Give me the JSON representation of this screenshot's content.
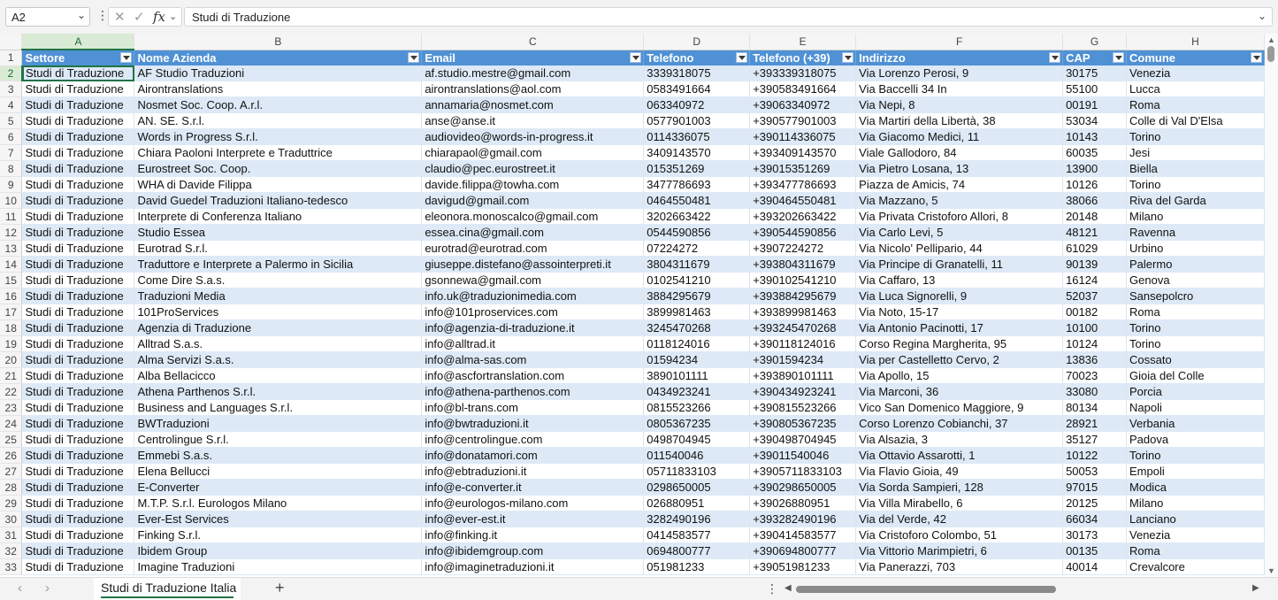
{
  "formula_bar": {
    "name_box": "A2",
    "formula": "Studi di Traduzione"
  },
  "columns": [
    "A",
    "B",
    "C",
    "D",
    "E",
    "F",
    "G",
    "H"
  ],
  "header_row_number": "1",
  "table_headers": [
    "Settore",
    "Nome Azienda",
    "Email",
    "Telefono",
    "Telefono (+39)",
    "Indirizzo",
    "CAP",
    "Comune"
  ],
  "rows": [
    {
      "n": "2",
      "cells": [
        "Studi di Traduzione",
        "AF Studio Traduzioni",
        "af.studio.mestre@gmail.com",
        "3339318075",
        "+393339318075",
        "Via Lorenzo Perosi, 9",
        "30175",
        "Venezia"
      ]
    },
    {
      "n": "3",
      "cells": [
        "Studi di Traduzione",
        "Airontranslations",
        "airontranslations@aol.com",
        "0583491664",
        "+390583491664",
        "Via Baccelli 34 In",
        "55100",
        "Lucca"
      ]
    },
    {
      "n": "4",
      "cells": [
        "Studi di Traduzione",
        "Nosmet Soc. Coop. A.r.l.",
        "annamaria@nosmet.com",
        "063340972",
        "+39063340972",
        "Via Nepi, 8",
        "00191",
        "Roma"
      ]
    },
    {
      "n": "5",
      "cells": [
        "Studi di Traduzione",
        "AN. SE. S.r.l.",
        "anse@anse.it",
        "0577901003",
        "+390577901003",
        "Via Martiri della Libertà, 38",
        "53034",
        "Colle di Val D'Elsa"
      ]
    },
    {
      "n": "6",
      "cells": [
        "Studi di Traduzione",
        "Words in Progress S.r.l.",
        "audiovideo@words-in-progress.it",
        "0114336075",
        "+390114336075",
        "Via Giacomo Medici, 11",
        "10143",
        "Torino"
      ]
    },
    {
      "n": "7",
      "cells": [
        "Studi di Traduzione",
        "Chiara Paoloni Interprete e Traduttrice",
        "chiarapaol@gmail.com",
        "3409143570",
        "+393409143570",
        "Viale Gallodoro, 84",
        "60035",
        "Jesi"
      ]
    },
    {
      "n": "8",
      "cells": [
        "Studi di Traduzione",
        "Eurostreet Soc. Coop.",
        "claudio@pec.eurostreet.it",
        "015351269",
        "+39015351269",
        "Via Pietro Losana, 13",
        "13900",
        "Biella"
      ]
    },
    {
      "n": "9",
      "cells": [
        "Studi di Traduzione",
        "WHA di Davide Filippa",
        "davide.filippa@towha.com",
        "3477786693",
        "+393477786693",
        "Piazza de Amicis, 74",
        "10126",
        "Torino"
      ]
    },
    {
      "n": "10",
      "cells": [
        "Studi di Traduzione",
        "David Guedel Traduzioni Italiano-tedesco",
        "davigud@gmail.com",
        "0464550481",
        "+390464550481",
        "Via Mazzano, 5",
        "38066",
        "Riva del Garda"
      ]
    },
    {
      "n": "11",
      "cells": [
        "Studi di Traduzione",
        "Interprete di Conferenza Italiano",
        "eleonora.monoscalco@gmail.com",
        "3202663422",
        "+393202663422",
        "Via Privata Cristoforo Allori, 8",
        "20148",
        "Milano"
      ]
    },
    {
      "n": "12",
      "cells": [
        "Studi di Traduzione",
        "Studio Essea",
        "essea.cina@gmail.com",
        "0544590856",
        "+390544590856",
        "Via Carlo Levi, 5",
        "48121",
        "Ravenna"
      ]
    },
    {
      "n": "13",
      "cells": [
        "Studi di Traduzione",
        "Eurotrad S.r.l.",
        "eurotrad@eurotrad.com",
        "07224272",
        "+3907224272",
        "Via Nicolo' Pellipario, 44",
        "61029",
        "Urbino"
      ]
    },
    {
      "n": "14",
      "cells": [
        "Studi di Traduzione",
        "Traduttore e Interprete a Palermo in Sicilia",
        "giuseppe.distefano@assointerpreti.it",
        "3804311679",
        "+393804311679",
        "Via Principe di Granatelli, 11",
        "90139",
        "Palermo"
      ]
    },
    {
      "n": "15",
      "cells": [
        "Studi di Traduzione",
        "Come Dire S.a.s.",
        "gsonnewa@gmail.com",
        "0102541210",
        "+390102541210",
        "Via Caffaro, 13",
        "16124",
        "Genova"
      ]
    },
    {
      "n": "16",
      "cells": [
        "Studi di Traduzione",
        "Traduzioni Media",
        "info.uk@traduzionimedia.com",
        "3884295679",
        "+393884295679",
        "Via Luca Signorelli, 9",
        "52037",
        "Sansepolcro"
      ]
    },
    {
      "n": "17",
      "cells": [
        "Studi di Traduzione",
        "101ProServices",
        "info@101proservices.com",
        "3899981463",
        "+393899981463",
        "Via Noto, 15-17",
        "00182",
        "Roma"
      ]
    },
    {
      "n": "18",
      "cells": [
        "Studi di Traduzione",
        "Agenzia di Traduzione",
        "info@agenzia-di-traduzione.it",
        "3245470268",
        "+393245470268",
        "Via Antonio Pacinotti, 17",
        "10100",
        "Torino"
      ]
    },
    {
      "n": "19",
      "cells": [
        "Studi di Traduzione",
        "Alltrad S.a.s.",
        "info@alltrad.it",
        "0118124016",
        "+390118124016",
        "Corso Regina Margherita, 95",
        "10124",
        "Torino"
      ]
    },
    {
      "n": "20",
      "cells": [
        "Studi di Traduzione",
        "Alma Servizi S.a.s.",
        "info@alma-sas.com",
        "01594234",
        "+3901594234",
        "Via per Castelletto Cervo, 2",
        "13836",
        "Cossato"
      ]
    },
    {
      "n": "21",
      "cells": [
        "Studi di Traduzione",
        "Alba Bellacicco",
        "info@ascfortranslation.com",
        "3890101111",
        "+393890101111",
        "Via Apollo, 15",
        "70023",
        "Gioia del Colle"
      ]
    },
    {
      "n": "22",
      "cells": [
        "Studi di Traduzione",
        "Athena Parthenos S.r.l.",
        "info@athena-parthenos.com",
        "0434923241",
        "+390434923241",
        "Via Marconi, 36",
        "33080",
        "Porcia"
      ]
    },
    {
      "n": "23",
      "cells": [
        "Studi di Traduzione",
        "Business and Languages S.r.l.",
        "info@bl-trans.com",
        "0815523266",
        "+390815523266",
        "Vico San Domenico Maggiore, 9",
        "80134",
        "Napoli"
      ]
    },
    {
      "n": "24",
      "cells": [
        "Studi di Traduzione",
        "BWTraduzioni",
        "info@bwtraduzioni.it",
        "0805367235",
        "+390805367235",
        "Corso Lorenzo Cobianchi, 37",
        "28921",
        "Verbania"
      ]
    },
    {
      "n": "25",
      "cells": [
        "Studi di Traduzione",
        "Centrolingue S.r.l.",
        "info@centrolingue.com",
        "0498704945",
        "+390498704945",
        "Via Alsazia, 3",
        "35127",
        "Padova"
      ]
    },
    {
      "n": "26",
      "cells": [
        "Studi di Traduzione",
        "Emmebi S.a.s.",
        "info@donatamori.com",
        "011540046",
        "+39011540046",
        "Via Ottavio Assarotti, 1",
        "10122",
        "Torino"
      ]
    },
    {
      "n": "27",
      "cells": [
        "Studi di Traduzione",
        "Elena Bellucci",
        "info@ebtraduzioni.it",
        "05711833103",
        "+3905711833103",
        "Via Flavio Gioia, 49",
        "50053",
        "Empoli"
      ]
    },
    {
      "n": "28",
      "cells": [
        "Studi di Traduzione",
        "E-Converter",
        "info@e-converter.it",
        "0298650005",
        "+390298650005",
        "Via Sorda Sampieri, 128",
        "97015",
        "Modica"
      ]
    },
    {
      "n": "29",
      "cells": [
        "Studi di Traduzione",
        "M.T.P. S.r.l. Eurologos Milano",
        "info@eurologos-milano.com",
        "026880951",
        "+39026880951",
        "Via Villa Mirabello, 6",
        "20125",
        "Milano"
      ]
    },
    {
      "n": "30",
      "cells": [
        "Studi di Traduzione",
        "Ever-Est Services",
        "info@ever-est.it",
        "3282490196",
        "+393282490196",
        "Via del Verde, 42",
        "66034",
        "Lanciano"
      ]
    },
    {
      "n": "31",
      "cells": [
        "Studi di Traduzione",
        "Finking S.r.l.",
        "info@finking.it",
        "0414583577",
        "+390414583577",
        "Via Cristoforo Colombo, 51",
        "30173",
        "Venezia"
      ]
    },
    {
      "n": "32",
      "cells": [
        "Studi di Traduzione",
        "Ibidem Group",
        "info@ibidemgroup.com",
        "0694800777",
        "+390694800777",
        "Via Vittorio Marimpietri, 6",
        "00135",
        "Roma"
      ]
    },
    {
      "n": "33",
      "cells": [
        "Studi di Traduzione",
        "Imagine Traduzioni",
        "info@imaginetraduzioni.it",
        "051981233",
        "+39051981233",
        "Via Panerazzi, 703",
        "40014",
        "Crevalcore"
      ]
    }
  ],
  "sheet_tabs": [
    "Studi di Traduzione Italia"
  ],
  "colors": {
    "table_header": "#4f91d4",
    "band_row": "#dde9f6",
    "selection": "#217346"
  },
  "icons": {
    "name_box_dropdown": "chevron-down-icon",
    "cancel": "close-icon",
    "enter": "check-icon",
    "insert_function": "fx-icon",
    "add_sheet": "plus-icon"
  }
}
